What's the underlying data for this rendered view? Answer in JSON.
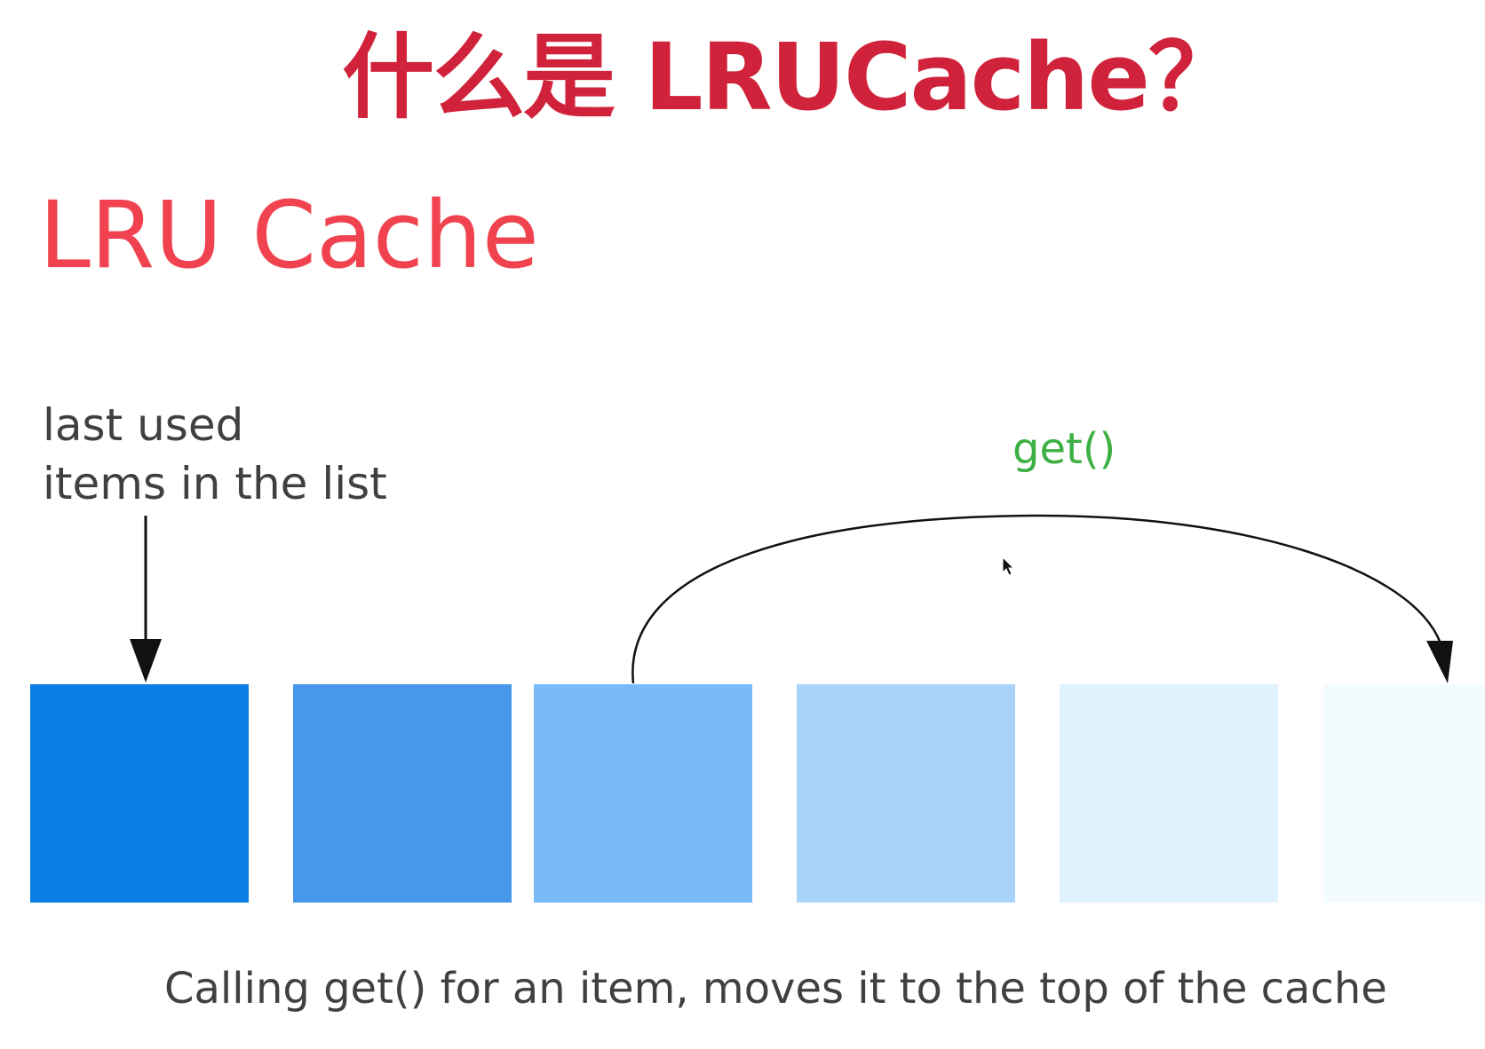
{
  "title": "什么是 LRUCache？",
  "subtitle": "LRU Cache",
  "caption": {
    "line1": "last used",
    "line2": "items in the list"
  },
  "get_label": "get()",
  "footer": "Calling get() for an item, moves it to the top of the cache",
  "colors": {
    "title": "#d0233b",
    "subtitle": "#f0434f",
    "text": "#404040",
    "get_label": "#3cb043",
    "arrow": "#111111"
  },
  "cache_blocks": [
    {
      "color": "#0b7ee6"
    },
    {
      "color": "#4798ea"
    },
    {
      "color": "#7bbaf9"
    },
    {
      "color": "#aad3fb"
    },
    {
      "color": "#dff2fd"
    },
    {
      "color": "#f3fbfe"
    }
  ]
}
